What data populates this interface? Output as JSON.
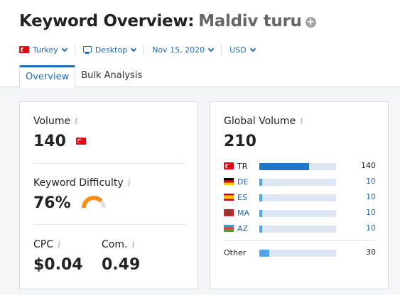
{
  "header": {
    "title": "Keyword Overview:",
    "keyword": "Maldiv turu",
    "plus_symbol": "+"
  },
  "filters": {
    "country": "Turkey",
    "device": "Desktop",
    "date": "Nov 15, 2020",
    "currency": "USD"
  },
  "tabs": [
    {
      "label": "Overview",
      "active": true
    },
    {
      "label": "Bulk Analysis",
      "active": false
    }
  ],
  "metrics": {
    "info_symbol": "i",
    "volume": {
      "label": "Volume",
      "value": "140"
    },
    "difficulty": {
      "label": "Keyword Difficulty",
      "value": "76%",
      "level": 0.76
    },
    "cpc": {
      "label": "CPC",
      "value": "$0.04"
    },
    "com": {
      "label": "Com.",
      "value": "0.49"
    }
  },
  "global": {
    "label": "Global Volume",
    "value": "210",
    "countries": [
      {
        "code": "TR",
        "value": "140",
        "share": 0.65
      },
      {
        "code": "DE",
        "value": "10",
        "share": 0.04
      },
      {
        "code": "ES",
        "value": "10",
        "share": 0.04
      },
      {
        "code": "MA",
        "value": "10",
        "share": 0.04
      },
      {
        "code": "AZ",
        "value": "10",
        "share": 0.04
      }
    ],
    "other": {
      "label": "Other",
      "value": "30",
      "share": 0.13
    }
  },
  "colors": {
    "accent": "#1f6bb8",
    "bar": "#1f77c7",
    "bar_light": "#4fa5e8",
    "gauge": "#f5901e"
  }
}
